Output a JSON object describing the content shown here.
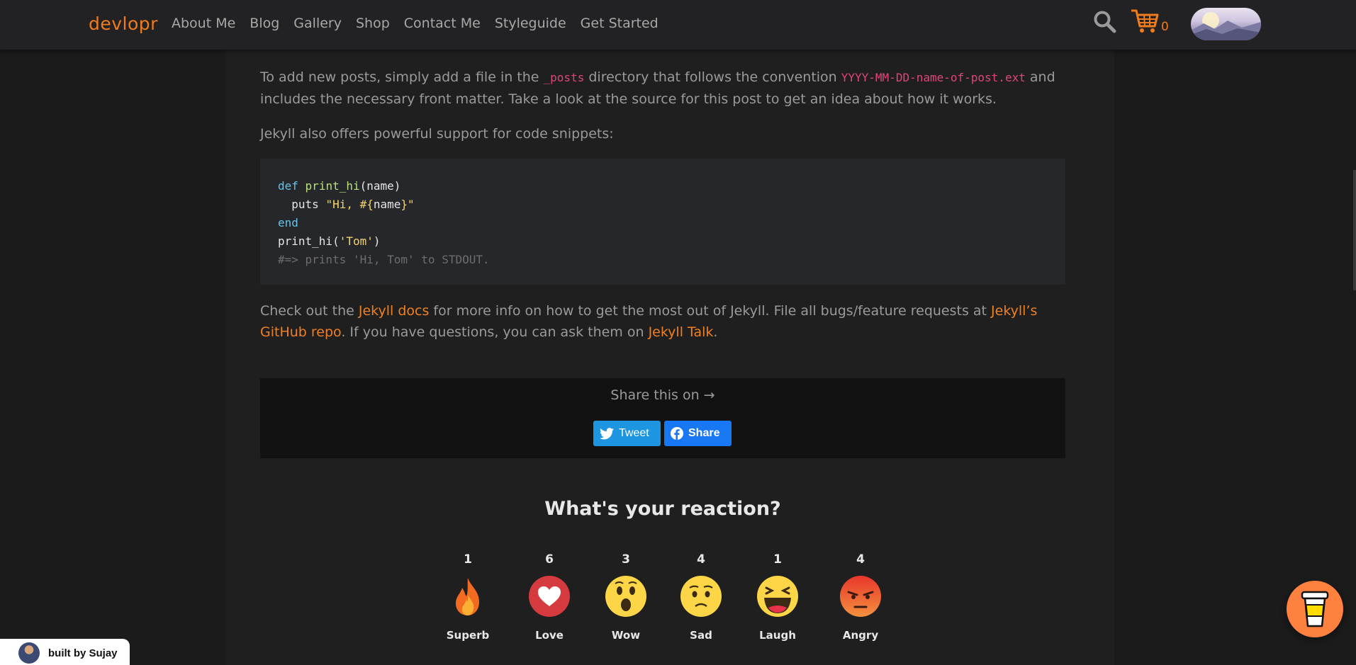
{
  "header": {
    "brand": "devlopr",
    "nav": [
      "About Me",
      "Blog",
      "Gallery",
      "Shop",
      "Contact Me",
      "Styleguide",
      "Get Started"
    ],
    "cart_count": "0",
    "icons": {
      "search": "search-icon",
      "cart": "cart-icon",
      "theme": "theme-toggle-icon"
    }
  },
  "content": {
    "p1": {
      "t1": "To add new posts, simply add a file in the ",
      "code1": "_posts",
      "t2": " directory that follows the convention ",
      "code2": "YYYY-MM-DD-name-of-post.ext",
      "t3": " and includes the necessary front matter. Take a look at the source for this post to get an idea about how it works."
    },
    "p2": "Jekyll also offers powerful support for code snippets:",
    "code": {
      "line1_kw": "def",
      "line1_fn": "print_hi",
      "line1_rest": "(name)",
      "line2_pre": "  puts ",
      "line2_str1": "\"Hi, #{",
      "line2_var": "name",
      "line2_str2": "}\"",
      "line3": "end",
      "line4_pre": "print_hi(",
      "line4_str": "'Tom'",
      "line4_post": ")",
      "line5": "#=> prints 'Hi, Tom' to STDOUT."
    },
    "p3": {
      "t1": "Check out the ",
      "link1": "Jekyll docs",
      "t2": " for more info on how to get the most out of Jekyll. File all bugs/feature requests at ",
      "link2": "Jekyll’s GitHub repo",
      "t3": ". If you have questions, you can ask them on ",
      "link3": "Jekyll Talk",
      "t4": "."
    }
  },
  "share": {
    "title": "Share this on →",
    "tweet": "Tweet",
    "facebook": "Share"
  },
  "reactions": {
    "title": "What's your reaction?",
    "items": [
      {
        "label": "Superb",
        "count": "1"
      },
      {
        "label": "Love",
        "count": "6"
      },
      {
        "label": "Wow",
        "count": "3"
      },
      {
        "label": "Sad",
        "count": "4"
      },
      {
        "label": "Laugh",
        "count": "1"
      },
      {
        "label": "Angry",
        "count": "4"
      }
    ]
  },
  "badge": {
    "text": "built by Sujay"
  },
  "colors": {
    "accent": "#f07c1b",
    "link": "#f0801f",
    "code_inline": "#e0457b",
    "twitter": "#1d95e0",
    "facebook": "#1877f2",
    "coffee": "#ff813f"
  }
}
